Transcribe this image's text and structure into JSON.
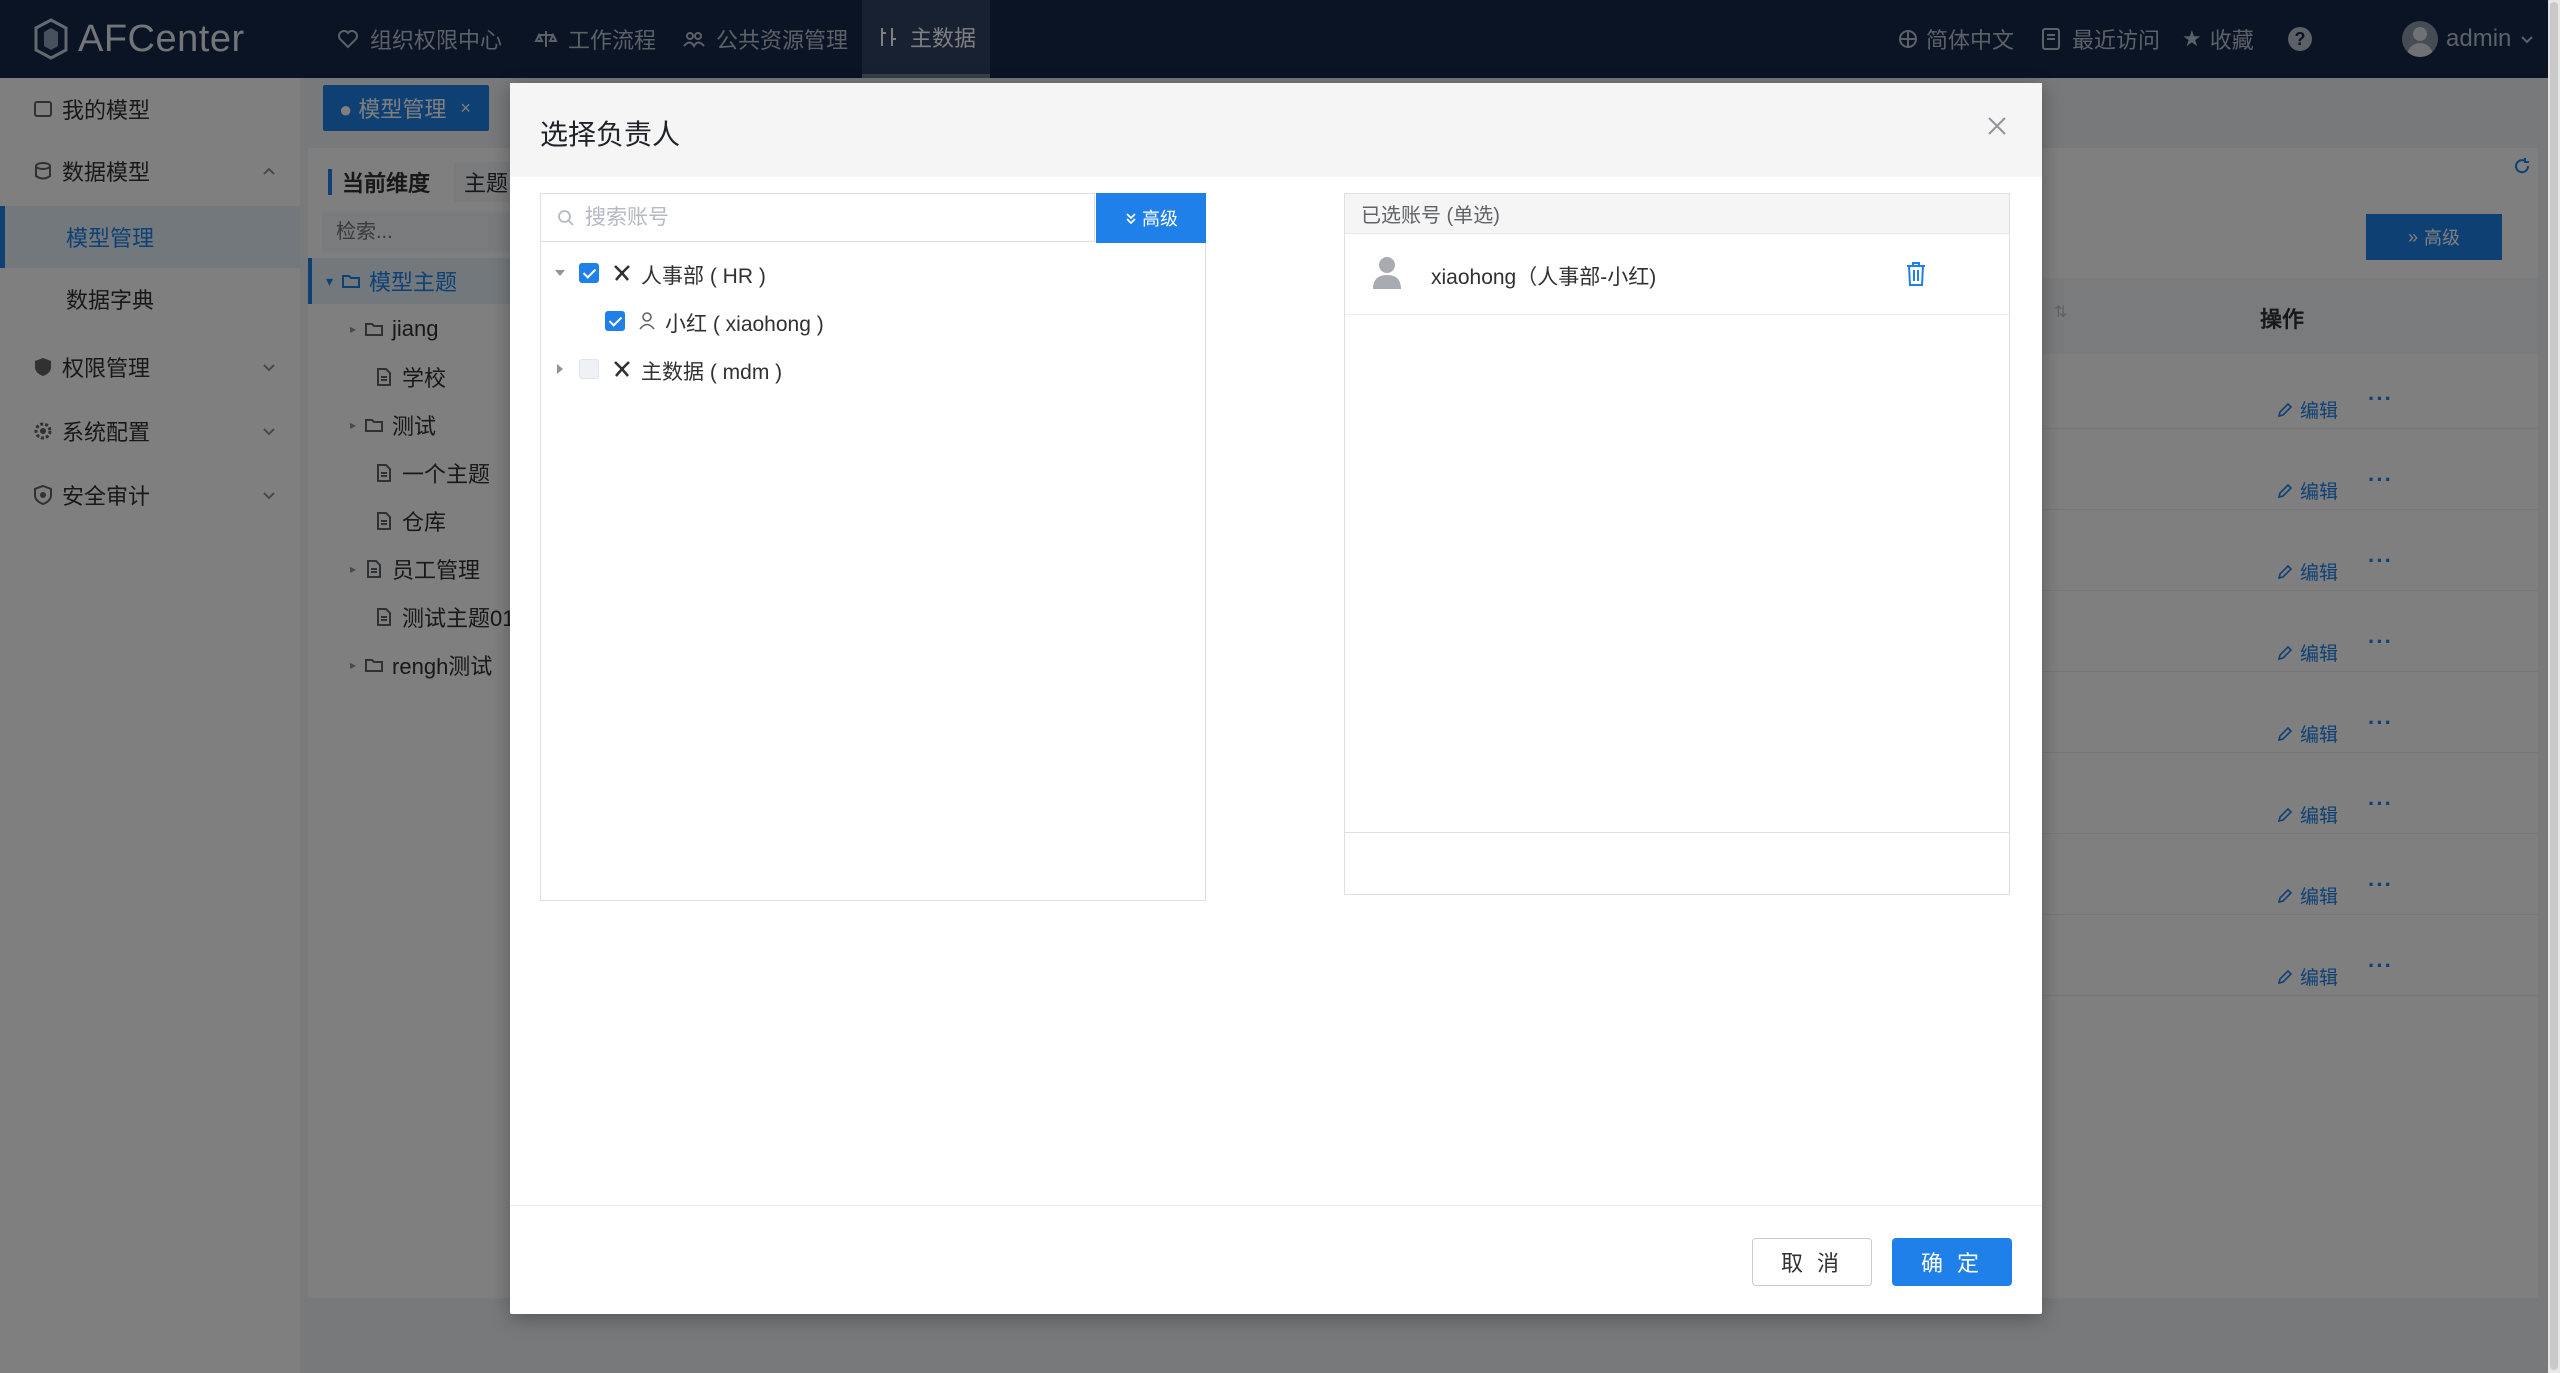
{
  "app": {
    "name": "AFCenter"
  },
  "topnav": [
    {
      "label": "组织权限中心",
      "icon": "heart-icon"
    },
    {
      "label": "工作流程",
      "icon": "scale-icon"
    },
    {
      "label": "公共资源管理",
      "icon": "users-icon"
    },
    {
      "label": "主数据",
      "icon": "tools-icon",
      "active": true
    }
  ],
  "topright": {
    "language": "简体中文",
    "recent": "最近访问",
    "favorites": "收藏",
    "help": "?",
    "user": "admin"
  },
  "sidebar": {
    "items": [
      {
        "label": "我的模型"
      },
      {
        "label": "数据模型"
      },
      {
        "label": "模型管理"
      },
      {
        "label": "数据字典"
      },
      {
        "label": "权限管理"
      },
      {
        "label": "系统配置"
      },
      {
        "label": "安全审计"
      }
    ]
  },
  "main": {
    "tab": "● 模型管理",
    "tab_close": "×",
    "dimension_label": "当前维度",
    "dimension_value": "主题",
    "search_placeholder": "检索...",
    "tree": [
      "模型主题",
      "jiang",
      "学校",
      "测试",
      "一个主题",
      "仓库",
      "员工管理",
      "测试主题01",
      "rengh测试"
    ],
    "advanced": "高级",
    "col_op": "操作",
    "row_edit": "编辑",
    "row_more": "···",
    "row_count": 8
  },
  "dialog": {
    "title": "选择负责人",
    "search_placeholder": "搜索账号",
    "advanced": "高级",
    "tree": [
      {
        "label": "人事部 ( HR )",
        "checked": true,
        "expanded": true
      },
      {
        "label": "小红 ( xiaohong )",
        "checked": true
      },
      {
        "label": "主数据 ( mdm )",
        "checked": false,
        "expanded": false
      }
    ],
    "selected_header": "已选账号 (单选)",
    "selected_item": "xiaohong（人事部-小红)",
    "cancel": "取 消",
    "confirm": "确 定"
  },
  "colors": {
    "accent": "#1e80e8",
    "header": "#14294a"
  }
}
